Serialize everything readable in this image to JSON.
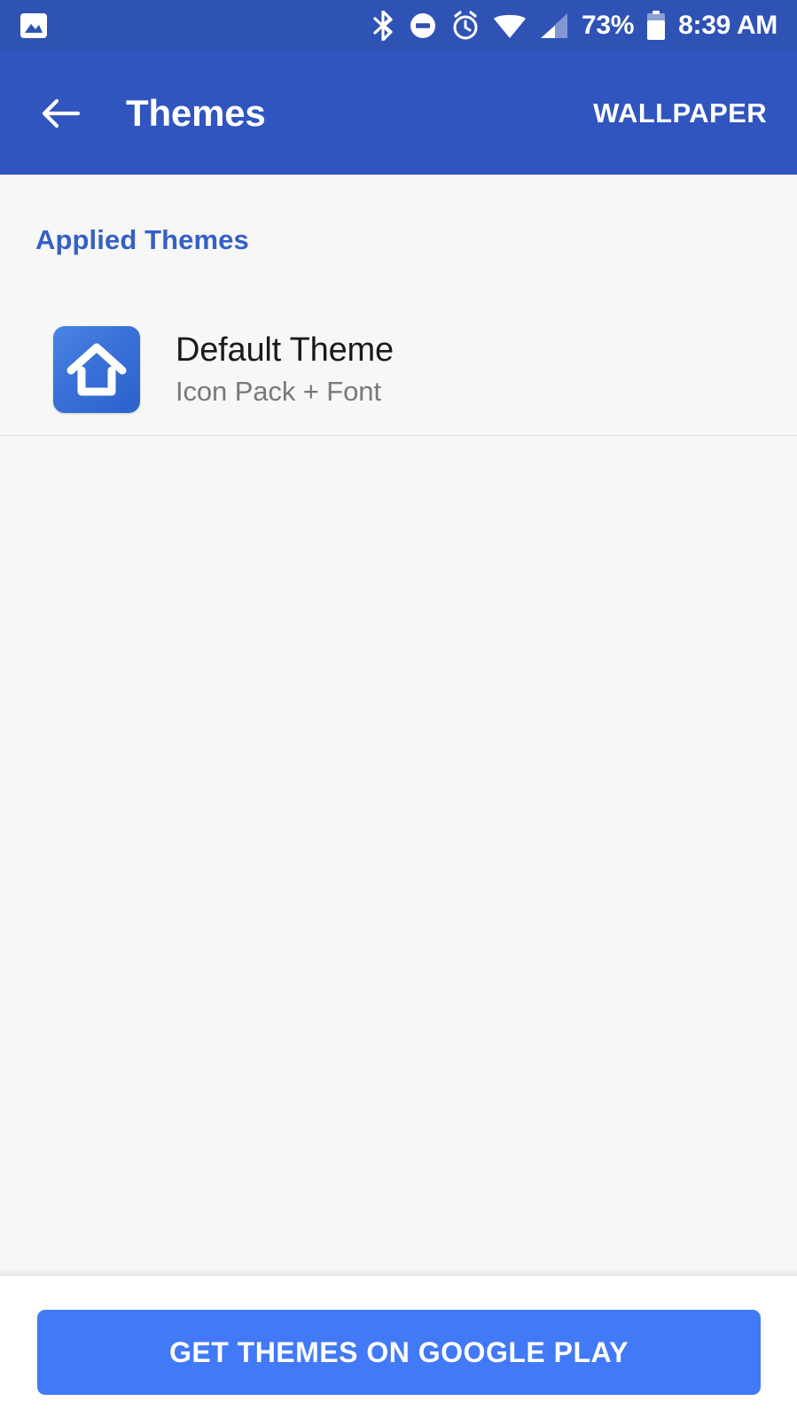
{
  "status_bar": {
    "notification_icons": [
      "photo-icon"
    ],
    "system_icons": [
      "bluetooth-icon",
      "do-not-disturb-icon",
      "alarm-icon",
      "wifi-icon",
      "cell-signal-icon"
    ],
    "battery_percent": "73%",
    "battery_icon": "battery-icon",
    "clock": "8:39 AM",
    "background_color": "#2f52b5"
  },
  "app_bar": {
    "back_icon": "arrow-back-icon",
    "title": "Themes",
    "action_label": "WALLPAPER",
    "background_color": "#3055be"
  },
  "content": {
    "section_header": "Applied Themes",
    "section_header_color": "#3560c4",
    "background_color": "#f7f7f7",
    "themes": [
      {
        "icon": "home-theme-icon",
        "icon_gradient_from": "#4b84e4",
        "icon_gradient_to": "#2c61cc",
        "title": "Default Theme",
        "subtitle": "Icon Pack + Font"
      }
    ]
  },
  "bottom_bar": {
    "cta_label": "GET THEMES ON GOOGLE PLAY",
    "cta_color": "#4279f6",
    "background_color": "#ffffff"
  }
}
